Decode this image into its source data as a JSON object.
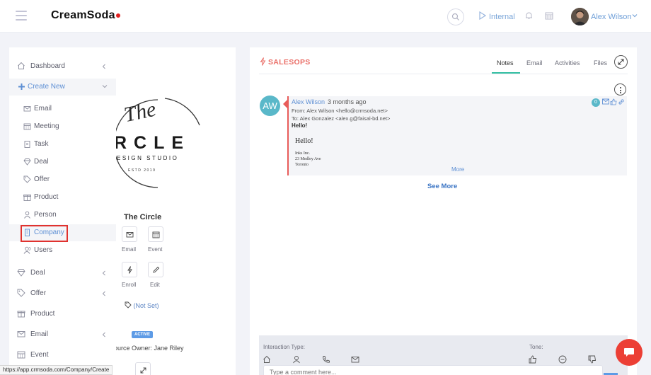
{
  "app": {
    "logo_text": "CreamSoda"
  },
  "topbar": {
    "mode_label": "Internal",
    "user_name": "Alex Wilson"
  },
  "sidebar": {
    "items": [
      {
        "label": "Dashboard",
        "icon": "home-icon"
      },
      {
        "label": "Create New",
        "icon": "plus-icon"
      },
      {
        "label": "Deal",
        "icon": "diamond-icon"
      },
      {
        "label": "Offer",
        "icon": "tag-icon"
      },
      {
        "label": "Product",
        "icon": "gift-icon"
      },
      {
        "label": "Email",
        "icon": "envelope-icon"
      },
      {
        "label": "Event",
        "icon": "calendar-icon"
      }
    ],
    "create_sub": [
      {
        "label": "Email",
        "icon": "envelope-icon"
      },
      {
        "label": "Meeting",
        "icon": "calendar-icon"
      },
      {
        "label": "Task",
        "icon": "clipboard-icon"
      },
      {
        "label": "Deal",
        "icon": "diamond-icon"
      },
      {
        "label": "Offer",
        "icon": "tag-icon"
      },
      {
        "label": "Product",
        "icon": "gift-icon"
      },
      {
        "label": "Person",
        "icon": "person-icon"
      },
      {
        "label": "Company",
        "icon": "building-icon"
      },
      {
        "label": "Users",
        "icon": "users-icon"
      }
    ]
  },
  "company": {
    "logo": {
      "line1": "The",
      "line2": "RCLE",
      "line3": "ESIGN STUDIO",
      "line4": "ESTD 2019"
    },
    "name": "The Circle",
    "actions": [
      {
        "label": "Email",
        "icon": "envelope-icon"
      },
      {
        "label": "Event",
        "icon": "calendar-icon"
      },
      {
        "label": "Enroll",
        "icon": "bolt-icon"
      },
      {
        "label": "Edit",
        "icon": "pencil-icon"
      }
    ],
    "tag_text": "(Not Set)",
    "status_badge": "ACTIVE",
    "owner_text": "ource Owner: Jane Riley"
  },
  "salesops": {
    "title": "SALESOPS",
    "tabs": [
      "Notes",
      "Email",
      "Activities",
      "Files"
    ],
    "active_tab": "Notes",
    "note": {
      "avatar_initials": "AW",
      "author": "Alex Wilson",
      "time": "3 months ago",
      "from": "From: Alex Wilson <hello@crmsoda.net>",
      "to": "To: Alex Gonzalez <alex.g@faisal-bd.net>",
      "greeting_bold": "Hello!",
      "body_hello": "Hello!",
      "body_line1": "Inks Inc.",
      "body_line2": "23 Medley Ave",
      "body_line3": "Toronto",
      "more_label": "More",
      "count_badge": "0"
    },
    "see_more": "See More",
    "interaction": {
      "type_label": "Interaction Type:",
      "tone_label": "Tone:",
      "comment_placeholder": "Type a comment here..."
    }
  },
  "statusbar": {
    "url": "https://app.crmsoda.com/Company/Create"
  },
  "colors": {
    "accent": "#5d8fd4",
    "salesops_red": "#ea6f68",
    "tab_underline": "#34bfa3",
    "fab": "#ec3f35"
  }
}
